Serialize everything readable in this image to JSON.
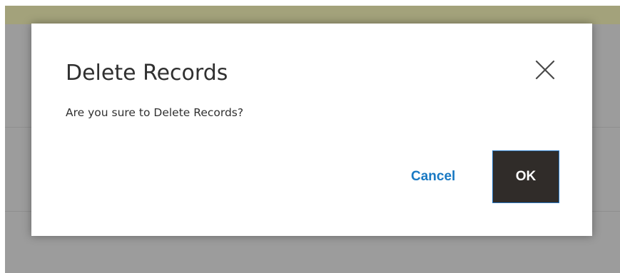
{
  "modal": {
    "title": "Delete Records",
    "message": "Are you sure to Delete Records?",
    "close_icon": "close-icon",
    "cancel_label": "Cancel",
    "ok_label": "OK"
  },
  "colors": {
    "overlay": "#9c9c9c",
    "top_bar": "#a3a27b",
    "modal_background": "#ffffff",
    "title_text": "#303030",
    "link_blue": "#1979c3",
    "primary_button": "#302c29",
    "primary_button_border": "#2b7ac4"
  }
}
